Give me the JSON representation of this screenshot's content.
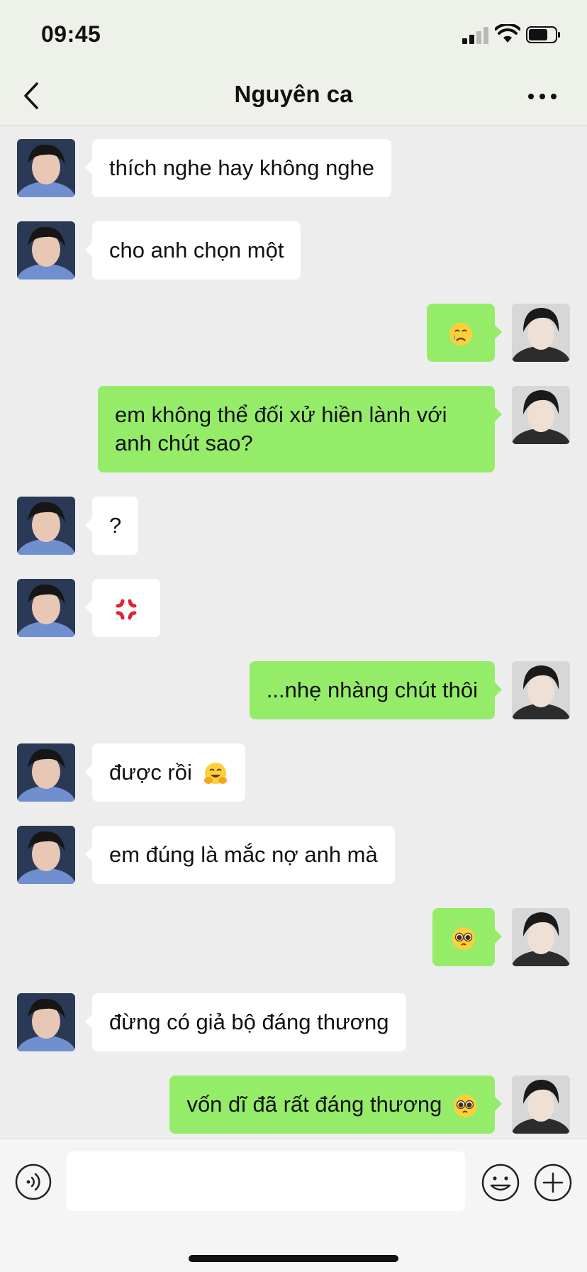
{
  "status_bar": {
    "time": "09:45",
    "signal_icon": "signal-bars-icon",
    "wifi_icon": "wifi-icon",
    "battery_icon": "battery-icon"
  },
  "nav": {
    "title": "Nguyên ca",
    "back_icon": "chevron-left-icon",
    "more_icon": "more-dots-icon"
  },
  "messages": [
    {
      "side": "left",
      "text": "thích nghe hay không nghe"
    },
    {
      "side": "left",
      "text": "cho anh chọn một"
    },
    {
      "side": "right",
      "text": "",
      "emoji": "crying-face-emoji"
    },
    {
      "side": "right",
      "text": "em không thể đối xử hiền lành với anh chút sao?"
    },
    {
      "side": "left",
      "text": "?"
    },
    {
      "side": "left",
      "text": "",
      "emoji": "anger-symbol-emoji"
    },
    {
      "side": "right",
      "text": "...nhẹ nhàng chút thôi"
    },
    {
      "side": "left",
      "text": "được rồi",
      "emoji": "hugging-face-emoji"
    },
    {
      "side": "left",
      "text": "em đúng là mắc nợ anh mà"
    },
    {
      "side": "right",
      "text": "",
      "emoji": "pleading-face-emoji"
    },
    {
      "side": "left",
      "text": "đừng có giả bộ đáng thương"
    },
    {
      "side": "right",
      "text": "vốn dĩ đã rất đáng thương",
      "emoji": "pleading-face-emoji"
    }
  ],
  "input_bar": {
    "value": "",
    "voice_icon": "voice-icon",
    "emoji_icon": "emoji-icon",
    "plus_icon": "plus-icon"
  },
  "colors": {
    "left_bubble": "#ffffff",
    "right_bubble": "#95ec69",
    "background": "#ededed"
  }
}
